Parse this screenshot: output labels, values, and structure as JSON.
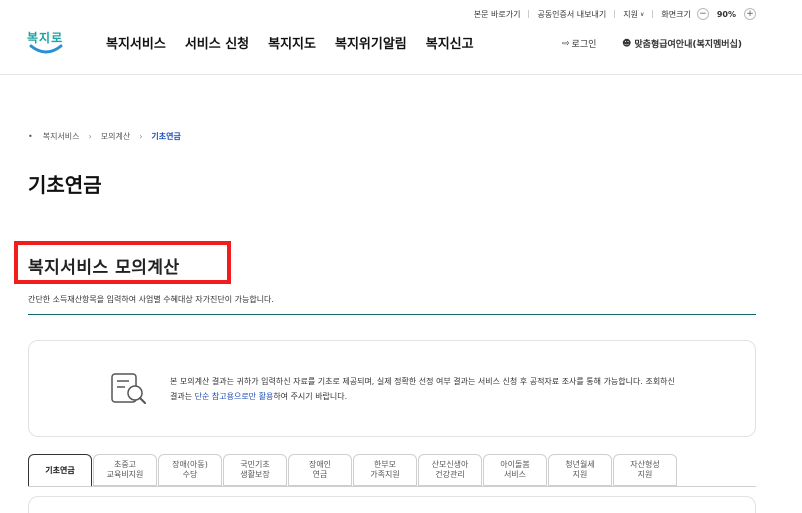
{
  "utility": {
    "skip_link": "본문 바로가기",
    "cert_export": "공동인증서 내보내기",
    "support": "지원",
    "zoom_label": "화면크기",
    "zoom_value": "90%",
    "zoom_minus": "−",
    "zoom_plus": "+"
  },
  "header": {
    "logo_text": "복지로",
    "nav": [
      "복지서비스",
      "서비스 신청",
      "복지지도",
      "복지위기알림",
      "복지신고"
    ],
    "login": "로그인",
    "custom_service": "맞춤형급여안내(복지멤버십)"
  },
  "breadcrumb": [
    "복지서비스",
    "모의계산",
    "기초연금"
  ],
  "page_title": "기초연금",
  "section": {
    "title": "복지서비스 모의계산",
    "description": "간단한 소득재산항목을 입력하여 사업별 수혜대상 자가진단이 가능합니다."
  },
  "notice": {
    "line1": "본 모의계산 결과는 귀하가 입력하신 자료를 기초로 제공되며, 실제 정확한 선정 여부 결과는 서비스 신청 후 공적자료 조사를 통해 가능합니다. 조회하신",
    "line2_pre": "결과는 ",
    "line2_highlight": "단순 참고용으로만 활용",
    "line2_post": "하여 주시기 바랍니다."
  },
  "tabs": [
    {
      "l1": "기초연금",
      "l2": ""
    },
    {
      "l1": "초중고",
      "l2": "교육비지원"
    },
    {
      "l1": "장애(아동)",
      "l2": "수당"
    },
    {
      "l1": "국민기초",
      "l2": "생활보장"
    },
    {
      "l1": "장애인",
      "l2": "연금"
    },
    {
      "l1": "한부모",
      "l2": "가족지원"
    },
    {
      "l1": "산모신생아",
      "l2": "건강관리"
    },
    {
      "l1": "아이돌봄",
      "l2": "서비스"
    },
    {
      "l1": "청년월세",
      "l2": "지원"
    },
    {
      "l1": "자산형성",
      "l2": "지원"
    }
  ],
  "colors": {
    "accent": "#1f4fb5",
    "highlight_box": "#f21c1c",
    "section_line": "#0f6b6d",
    "logo": "#1aa3a0"
  }
}
